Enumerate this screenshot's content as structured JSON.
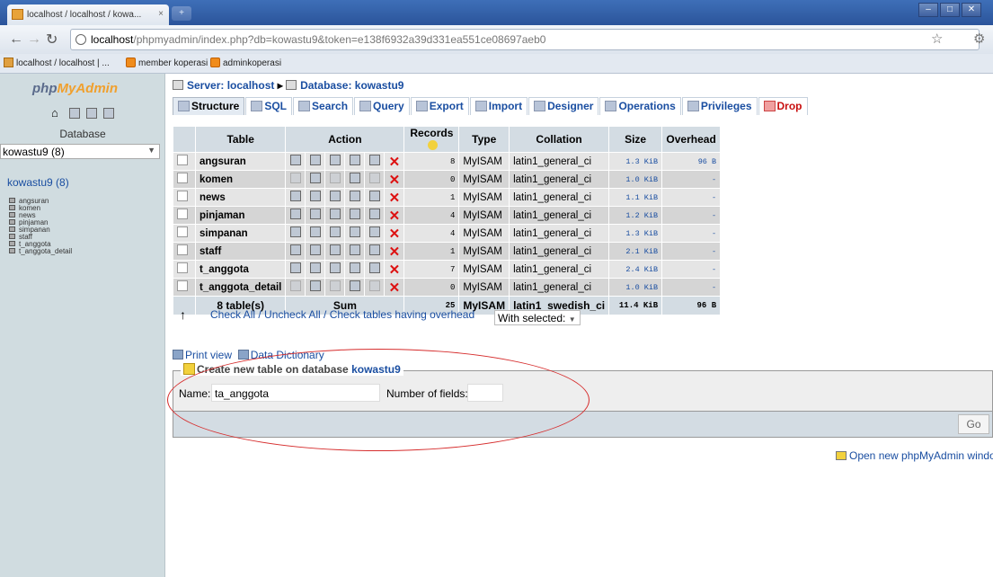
{
  "browser": {
    "tab_title": "localhost / localhost / kowa...",
    "tab_close": "×",
    "newtab": "+",
    "win": [
      "–",
      "□",
      "✕"
    ],
    "url_host": "localhost",
    "url_path": "/phpmyadmin/index.php?db=kowastu9&token=e138f6932a39d331ea551ce08697aeb0",
    "bookmarks": [
      "localhost / localhost | ...",
      "member koperasi",
      "adminkoperasi"
    ]
  },
  "nav": {
    "logo_a": "php",
    "logo_b": "MyAdmin",
    "db_label": "Database",
    "db_select": "kowastu9 (8)",
    "db_title": "kowastu9 (8)",
    "tables": [
      "angsuran",
      "komen",
      "news",
      "pinjaman",
      "simpanan",
      "staff",
      "t_anggota",
      "t_anggota_detail"
    ]
  },
  "breadcrumb": {
    "server": "Server: localhost",
    "sep": "▸",
    "database": "Database: kowastu9"
  },
  "tabs": [
    "Structure",
    "SQL",
    "Search",
    "Query",
    "Export",
    "Import",
    "Designer",
    "Operations",
    "Privileges",
    "Drop"
  ],
  "table_headers": {
    "table": "Table",
    "action": "Action",
    "records": "Records",
    "type": "Type",
    "collation": "Collation",
    "size": "Size",
    "overhead": "Overhead"
  },
  "rows": [
    {
      "name": "angsuran",
      "records": "8",
      "type": "MyISAM",
      "collation": "latin1_general_ci",
      "size": "1.3 KiB",
      "overhead": "96 B"
    },
    {
      "name": "komen",
      "records": "0",
      "type": "MyISAM",
      "collation": "latin1_general_ci",
      "size": "1.0 KiB",
      "overhead": "-"
    },
    {
      "name": "news",
      "records": "1",
      "type": "MyISAM",
      "collation": "latin1_general_ci",
      "size": "1.1 KiB",
      "overhead": "-"
    },
    {
      "name": "pinjaman",
      "records": "4",
      "type": "MyISAM",
      "collation": "latin1_general_ci",
      "size": "1.2 KiB",
      "overhead": "-"
    },
    {
      "name": "simpanan",
      "records": "4",
      "type": "MyISAM",
      "collation": "latin1_general_ci",
      "size": "1.3 KiB",
      "overhead": "-"
    },
    {
      "name": "staff",
      "records": "1",
      "type": "MyISAM",
      "collation": "latin1_general_ci",
      "size": "2.1 KiB",
      "overhead": "-"
    },
    {
      "name": "t_anggota",
      "records": "7",
      "type": "MyISAM",
      "collation": "latin1_general_ci",
      "size": "2.4 KiB",
      "overhead": "-"
    },
    {
      "name": "t_anggota_detail",
      "records": "0",
      "type": "MyISAM",
      "collation": "latin1_general_ci",
      "size": "1.0 KiB",
      "overhead": "-"
    }
  ],
  "summary": {
    "tables": "8 table(s)",
    "sum": "Sum",
    "records": "25",
    "type": "MyISAM",
    "collation": "latin1_swedish_ci",
    "size": "11.4 KiB",
    "overhead": "96 B"
  },
  "check": {
    "arrow": "↑",
    "links": "Check All / Uncheck All / Check tables having overhead",
    "with_selected": "With selected:"
  },
  "print": {
    "print_view": "Print view",
    "data_dictionary": "Data Dictionary"
  },
  "create": {
    "legend": "Create new table on database",
    "db": "kowastu9",
    "name_label": "Name:",
    "name_value": "ta_anggota",
    "fields_label": "Number of fields:",
    "go": "Go"
  },
  "open_window": "Open new phpMyAdmin window",
  "colors": {
    "link": "#1a4ea1",
    "header_bg": "#d3dce3",
    "row_odd": "#e5e5e5",
    "row_even": "#d5d5d5",
    "annotation": "#d62d2d"
  }
}
